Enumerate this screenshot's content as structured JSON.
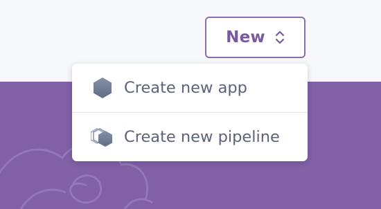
{
  "header": {
    "new_button": {
      "label": "New",
      "icon": "updown-chevron-icon"
    }
  },
  "new_menu": {
    "items": [
      {
        "label": "Create new app",
        "icon": "hexagon-app-icon"
      },
      {
        "label": "Create new pipeline",
        "icon": "pipeline-stack-icon"
      }
    ]
  },
  "colors": {
    "accent": "#7a5a9f",
    "hero_background": "#8160a6",
    "page_background": "#f7f8fb",
    "menu_text": "#5a6378",
    "icon_fill": "#6f7c95"
  }
}
